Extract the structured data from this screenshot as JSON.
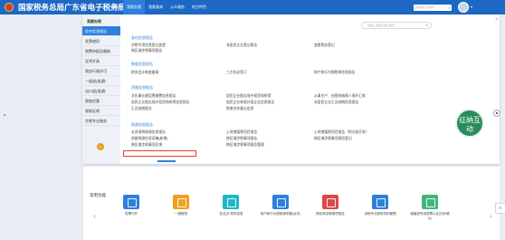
{
  "header": {
    "site_title": "国家税务总局广东省电子税务局",
    "nav": [
      "首页",
      "我要办税",
      "我要查询",
      "公众服务",
      "地方特色"
    ],
    "active_nav": 1,
    "search_placeholder": "搜索输入关键字",
    "colors": {
      "bar": "#1d68c4",
      "active": "#2f7fdc"
    }
  },
  "panel": {
    "search_placeholder": "请输入关键字进行搜索",
    "close": "×",
    "sidebar_title": "我要办税",
    "sidebar_items": [
      "综合信息报告",
      "发票使用",
      "税费申报及缴纳",
      "证明开具",
      "税务行政许可",
      "一般退(抵)税",
      "出口退(抵)税",
      "税收优惠",
      "税收证明",
      "涉税专业服务"
    ],
    "sidebar_active": 0,
    "sections": {
      "s1": "身份信息报告",
      "s2": "制度信息报告",
      "s3": "资格信息报告",
      "s4": "税源信息报告"
    },
    "links": {
      "a1": "涉税专用信息登记变更",
      "a2": "非居民企业登记报告",
      "a3": "变更税务登记",
      "a4": "跨区域涉税事项报告",
      "b1": "财务会计制度备案",
      "b2": "三方协议签订",
      "b3": "财产和行为税税源信息报告",
      "c1": "文化事业建设费缴费信息报告",
      "c2": "居民企业报告境外投资和所得",
      "c3": "从事生产、经营的纳税人境外汇款",
      "c4": "居民企业报告境外投资和所得信息报告",
      "c5": "居民企业参股外国企业信息报告",
      "c6": "非居民企业汇总纳税信息报告",
      "c7": "汇总纳税报告",
      "c8": "税收合作备忘信息",
      "d1": "水资源税税源信息报告",
      "d2": "土地增值税项目报告",
      "d3": "土地增值税项目报告（附分段开发）",
      "d4": "房屋税源信息采集(新增)",
      "d5": "跨区域涉税事项报告",
      "d6": "跨区域涉税事项报验登记",
      "d7": "跨区域涉税事项反馈",
      "d8": "跨区域涉税事项报告管理"
    }
  },
  "favorites": {
    "title": "常用功能",
    "prev": "‹",
    "next": "›",
    "items": [
      {
        "label": "发票代开",
        "color": "#2f7fdc"
      },
      {
        "label": "一键报税",
        "color": "#f0a021"
      },
      {
        "label": "\"实名办\"税务信息",
        "color": "#1fb6c9"
      },
      {
        "label": "财产和行为税税源采集(合并)",
        "color": "#2f7fdc"
      },
      {
        "label": "跨区域涉税事项报告",
        "color": "#d94a4a"
      },
      {
        "label": "涉税专业服务机构管理",
        "color": "#2f7fdc"
      },
      {
        "label": "增值税专用发票认证(初步确认)",
        "color": "#44b57a"
      }
    ]
  },
  "floating": {
    "assistant": "征纳互动"
  },
  "side_button": "≡"
}
